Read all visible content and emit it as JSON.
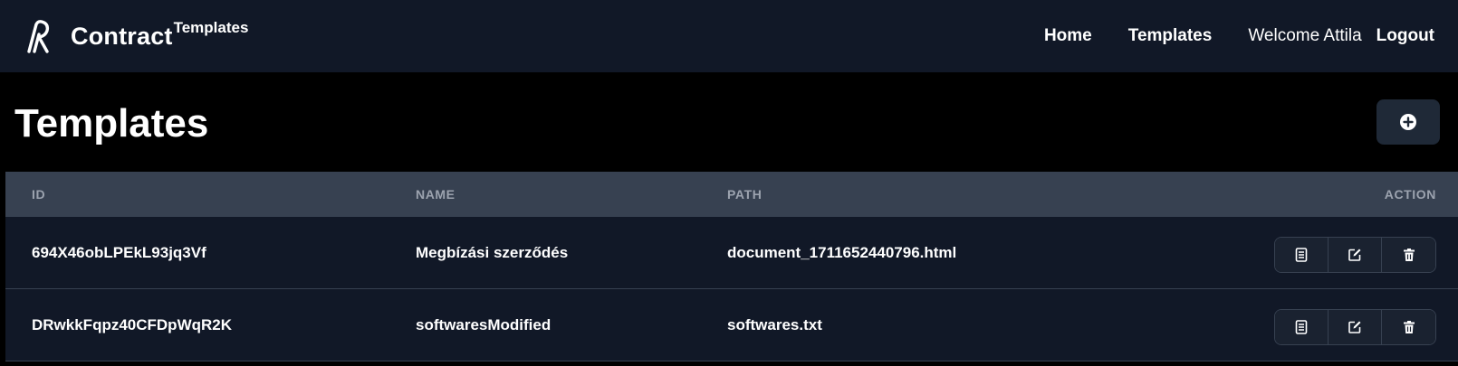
{
  "navbar": {
    "brand_name": "Contract",
    "brand_sup": "Templates",
    "links": {
      "home": "Home",
      "templates": "Templates",
      "welcome": "Welcome Attila",
      "logout": "Logout"
    }
  },
  "page": {
    "title": "Templates",
    "add_icon": "plus-circle-icon"
  },
  "table": {
    "headers": {
      "id": "ID",
      "name": "NAME",
      "path": "PATH",
      "action": "ACTION"
    },
    "rows": [
      {
        "id": "694X46obLPEkL93jq3Vf",
        "name": "Megbízási szerződés",
        "path": "document_1711652440796.html",
        "actions": [
          "document-icon",
          "edit-icon",
          "trash-icon"
        ]
      },
      {
        "id": "DRwkkFqpz40CFDpWqR2K",
        "name": "softwaresModified",
        "path": "softwares.txt",
        "actions": [
          "document-icon",
          "edit-icon",
          "trash-icon"
        ]
      }
    ]
  },
  "colors": {
    "navbar_bg": "#111827",
    "page_bg": "#000000",
    "table_header_bg": "#374151",
    "row_bg": "#111827",
    "header_text": "#9ca3af",
    "button_bg": "#1f2937"
  }
}
